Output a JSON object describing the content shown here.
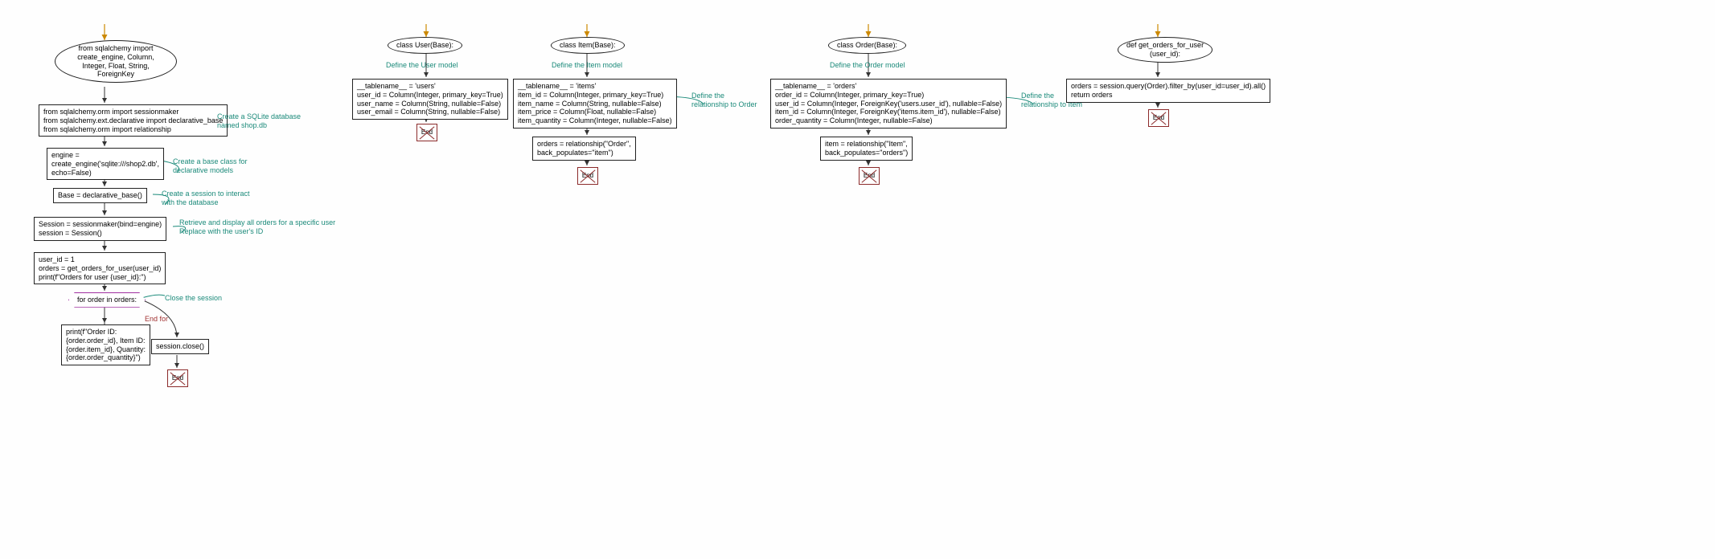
{
  "main": {
    "start": "from sqlalchemy import\ncreate_engine, Column,\nInteger, Float, String,\nForeignKey",
    "n2": "from sqlalchemy.orm import sessionmaker\nfrom sqlalchemy.ext.declarative import declarative_base\nfrom sqlalchemy.orm import relationship",
    "a1": "Create a SQLite database\nnamed shop.db",
    "n3": "engine =\ncreate_engine('sqlite:///shop2.db',\necho=False)",
    "a2": "Create a base class for\ndeclarative models",
    "n4": "Base = declarative_base()",
    "a3": "Create a session to interact\nwith the database",
    "n5": "Session = sessionmaker(bind=engine)\nsession = Session()",
    "a4": "Retrieve and display all orders for a specific user\nReplace with the user's ID",
    "n6": "user_id = 1\norders = get_orders_for_user(user_id)\nprint(f\"Orders for user {user_id}:\")",
    "loop": "for order in orders:",
    "a5": "Close the session",
    "endfor": "End for",
    "n7": "print(f\"Order ID:\n{order.order_id}, Item ID:\n{order.item_id}, Quantity:\n{order.order_quantity}\")",
    "n8": "session.close()",
    "end": "End"
  },
  "user": {
    "start": "class User(Base):",
    "annot": "Define the User model",
    "body": "__tablename__ = 'users'\nuser_id = Column(Integer, primary_key=True)\nuser_name = Column(String, nullable=False)\nuser_email = Column(String, nullable=False)",
    "end": "End"
  },
  "item": {
    "start": "class Item(Base):",
    "annot": "Define the Item model",
    "body": "__tablename__ = 'items'\nitem_id = Column(Integer, primary_key=True)\nitem_name = Column(String, nullable=False)\nitem_price = Column(Float, nullable=False)\nitem_quantity = Column(Integer, nullable=False)",
    "a2": "Define the\nrelationship to Order",
    "rel": "orders = relationship(\"Order\",\nback_populates=\"item\")",
    "end": "End"
  },
  "order": {
    "start": "class Order(Base):",
    "annot": "Define the Order model",
    "body": "__tablename__ = 'orders'\norder_id = Column(Integer, primary_key=True)\nuser_id = Column(Integer, ForeignKey('users.user_id'), nullable=False)\nitem_id = Column(Integer, ForeignKey('items.item_id'), nullable=False)\norder_quantity = Column(Integer, nullable=False)",
    "a2": "Define the\nrelationship to Item",
    "rel": "item = relationship(\"Item\",\nback_populates=\"orders\")",
    "end": "End"
  },
  "func": {
    "start": "def get_orders_for_user\n(user_id):",
    "body": "orders = session.query(Order).filter_by(user_id=user_id).all()\nreturn orders",
    "end": "End"
  }
}
